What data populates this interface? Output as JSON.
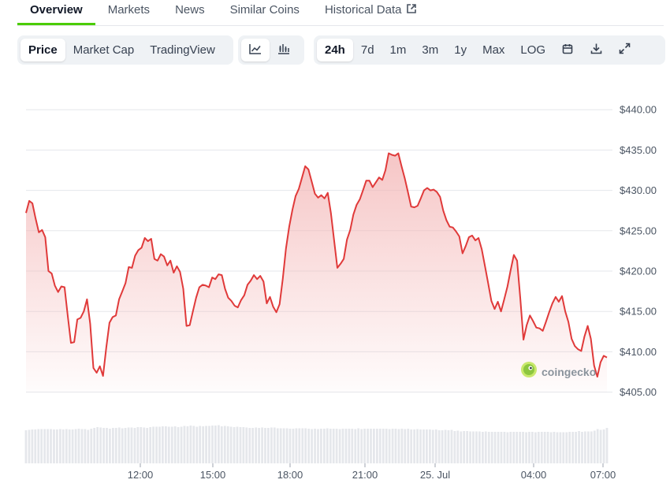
{
  "tabs": [
    {
      "label": "Overview",
      "active": true
    },
    {
      "label": "Markets"
    },
    {
      "label": "News"
    },
    {
      "label": "Similar Coins"
    },
    {
      "label": "Historical Data",
      "icon": "external-link-icon"
    }
  ],
  "toolbar": {
    "metric_buttons": [
      "Price",
      "Market Cap",
      "TradingView"
    ],
    "active_metric": "Price",
    "chart_type_icons": [
      "line-chart-icon",
      "candlestick-chart-icon"
    ],
    "range_buttons": [
      "24h",
      "7d",
      "1m",
      "3m",
      "1y",
      "Max",
      "LOG"
    ],
    "active_range": "24h",
    "action_icons": [
      "calendar-icon",
      "download-icon",
      "expand-icon"
    ]
  },
  "watermark": {
    "text": "coingecko",
    "icon": "gecko-logo-icon"
  },
  "colors": {
    "line": "#e03a3a",
    "fill_top": "#f3b3b3",
    "grid": "#e5e7eb",
    "active_tab": "#4bcc00",
    "volume": "#e5e7eb"
  },
  "chart_data": {
    "type": "area",
    "y_ticks": [
      "$440.00",
      "$435.00",
      "$430.00",
      "$425.00",
      "$420.00",
      "$415.00",
      "$410.00",
      "$405.00"
    ],
    "x_ticks": [
      "12:00",
      "15:00",
      "18:00",
      "21:00",
      "25. Jul",
      "04:00",
      "07:00"
    ],
    "ylim": [
      403,
      443
    ],
    "grid": true,
    "price": [
      427.2,
      428.7,
      428.4,
      426.5,
      424.8,
      425.1,
      424.2,
      420.0,
      419.7,
      418.2,
      417.4,
      418.1,
      418.0,
      414.5,
      411.1,
      411.2,
      414.0,
      414.2,
      415.0,
      416.5,
      413.5,
      408.0,
      407.4,
      408.2,
      407.0,
      410.5,
      413.6,
      414.3,
      414.5,
      416.5,
      417.5,
      418.5,
      420.5,
      420.4,
      421.9,
      422.6,
      422.9,
      424.1,
      423.7,
      424.0,
      421.5,
      421.3,
      422.1,
      421.8,
      420.7,
      421.3,
      419.8,
      420.6,
      419.9,
      417.8,
      413.2,
      413.3,
      415.0,
      416.7,
      418.0,
      418.3,
      418.2,
      418.0,
      419.2,
      419.0,
      419.6,
      419.5,
      417.8,
      416.7,
      416.3,
      415.7,
      415.5,
      416.4,
      417.0,
      418.3,
      418.8,
      419.5,
      419.0,
      419.4,
      418.7,
      416.0,
      416.8,
      415.6,
      414.9,
      415.9,
      419.0,
      422.8,
      425.5,
      427.6,
      429.3,
      430.2,
      431.6,
      433.0,
      432.6,
      431.1,
      429.6,
      429.1,
      429.4,
      429.0,
      429.7,
      427.2,
      423.8,
      420.4,
      420.9,
      421.5,
      423.9,
      425.1,
      427.0,
      428.2,
      428.9,
      430.0,
      431.2,
      431.2,
      430.4,
      431.0,
      431.6,
      431.3,
      432.5,
      434.6,
      434.4,
      434.3,
      434.6,
      433.0,
      431.5,
      429.8,
      428.0,
      427.9,
      428.1,
      429.0,
      430.0,
      430.3,
      430.0,
      430.1,
      429.8,
      429.2,
      427.5,
      426.3,
      425.5,
      425.4,
      424.9,
      424.3,
      422.2,
      423.1,
      424.2,
      424.4,
      423.8,
      424.1,
      422.7,
      420.6,
      418.5,
      416.3,
      415.3,
      416.2,
      415.0,
      416.5,
      418.1,
      420.1,
      422.0,
      421.3,
      416.6,
      411.5,
      413.3,
      414.5,
      413.8,
      413.0,
      412.9,
      412.6,
      413.7,
      414.9,
      416.0,
      416.8,
      416.2,
      416.9,
      415.0,
      413.7,
      411.6,
      410.7,
      410.3,
      410.1,
      411.9,
      413.2,
      411.6,
      408.3,
      406.9,
      408.7,
      409.5,
      409.3
    ],
    "volume": [
      0.84,
      0.85,
      0.86,
      0.86,
      0.87,
      0.87,
      0.87,
      0.87,
      0.87,
      0.86,
      0.86,
      0.87,
      0.86,
      0.87,
      0.86,
      0.86,
      0.87,
      0.88,
      0.87,
      0.87,
      0.85,
      0.88,
      0.9,
      0.92,
      0.91,
      0.9,
      0.9,
      0.88,
      0.9,
      0.9,
      0.91,
      0.89,
      0.9,
      0.91,
      0.91,
      0.9,
      0.92,
      0.92,
      0.91,
      0.9,
      0.92,
      0.93,
      0.93,
      0.93,
      0.94,
      0.94,
      0.93,
      0.93,
      0.94,
      0.92,
      0.93,
      0.95,
      0.94,
      0.96,
      0.95,
      0.93,
      0.95,
      0.94,
      0.95,
      0.95,
      0.96,
      0.96,
      0.97,
      0.94,
      0.95,
      0.94,
      0.93,
      0.92,
      0.93,
      0.92,
      0.92,
      0.91,
      0.9,
      0.9,
      0.91,
      0.9,
      0.91,
      0.9,
      0.9,
      0.91,
      0.91,
      0.89,
      0.89,
      0.89,
      0.89,
      0.88,
      0.88,
      0.89,
      0.89,
      0.89,
      0.89,
      0.88,
      0.87,
      0.88,
      0.87,
      0.88,
      0.88,
      0.89,
      0.88,
      0.88,
      0.88,
      0.87,
      0.88,
      0.88,
      0.88,
      0.88,
      0.87,
      0.89,
      0.87,
      0.88,
      0.88,
      0.88,
      0.88,
      0.88,
      0.88,
      0.88,
      0.88,
      0.87,
      0.88,
      0.88,
      0.87,
      0.88,
      0.87,
      0.88,
      0.86,
      0.86,
      0.87,
      0.86,
      0.86,
      0.86,
      0.86,
      0.85,
      0.86,
      0.84,
      0.84,
      0.85,
      0.84,
      0.85,
      0.82,
      0.83,
      0.81,
      0.82,
      0.82,
      0.81,
      0.81,
      0.81,
      0.81,
      0.8,
      0.81,
      0.8,
      0.8,
      0.8,
      0.8,
      0.8,
      0.8,
      0.79,
      0.8,
      0.8,
      0.8,
      0.8,
      0.8,
      0.79,
      0.8,
      0.8,
      0.79,
      0.8,
      0.8,
      0.8,
      0.8,
      0.79,
      0.8,
      0.79,
      0.79,
      0.79,
      0.79,
      0.8,
      0.8,
      0.8,
      0.82,
      0.8,
      0.81,
      0.81,
      0.81,
      0.83,
      0.87,
      0.85,
      0.86,
      0.9
    ]
  }
}
